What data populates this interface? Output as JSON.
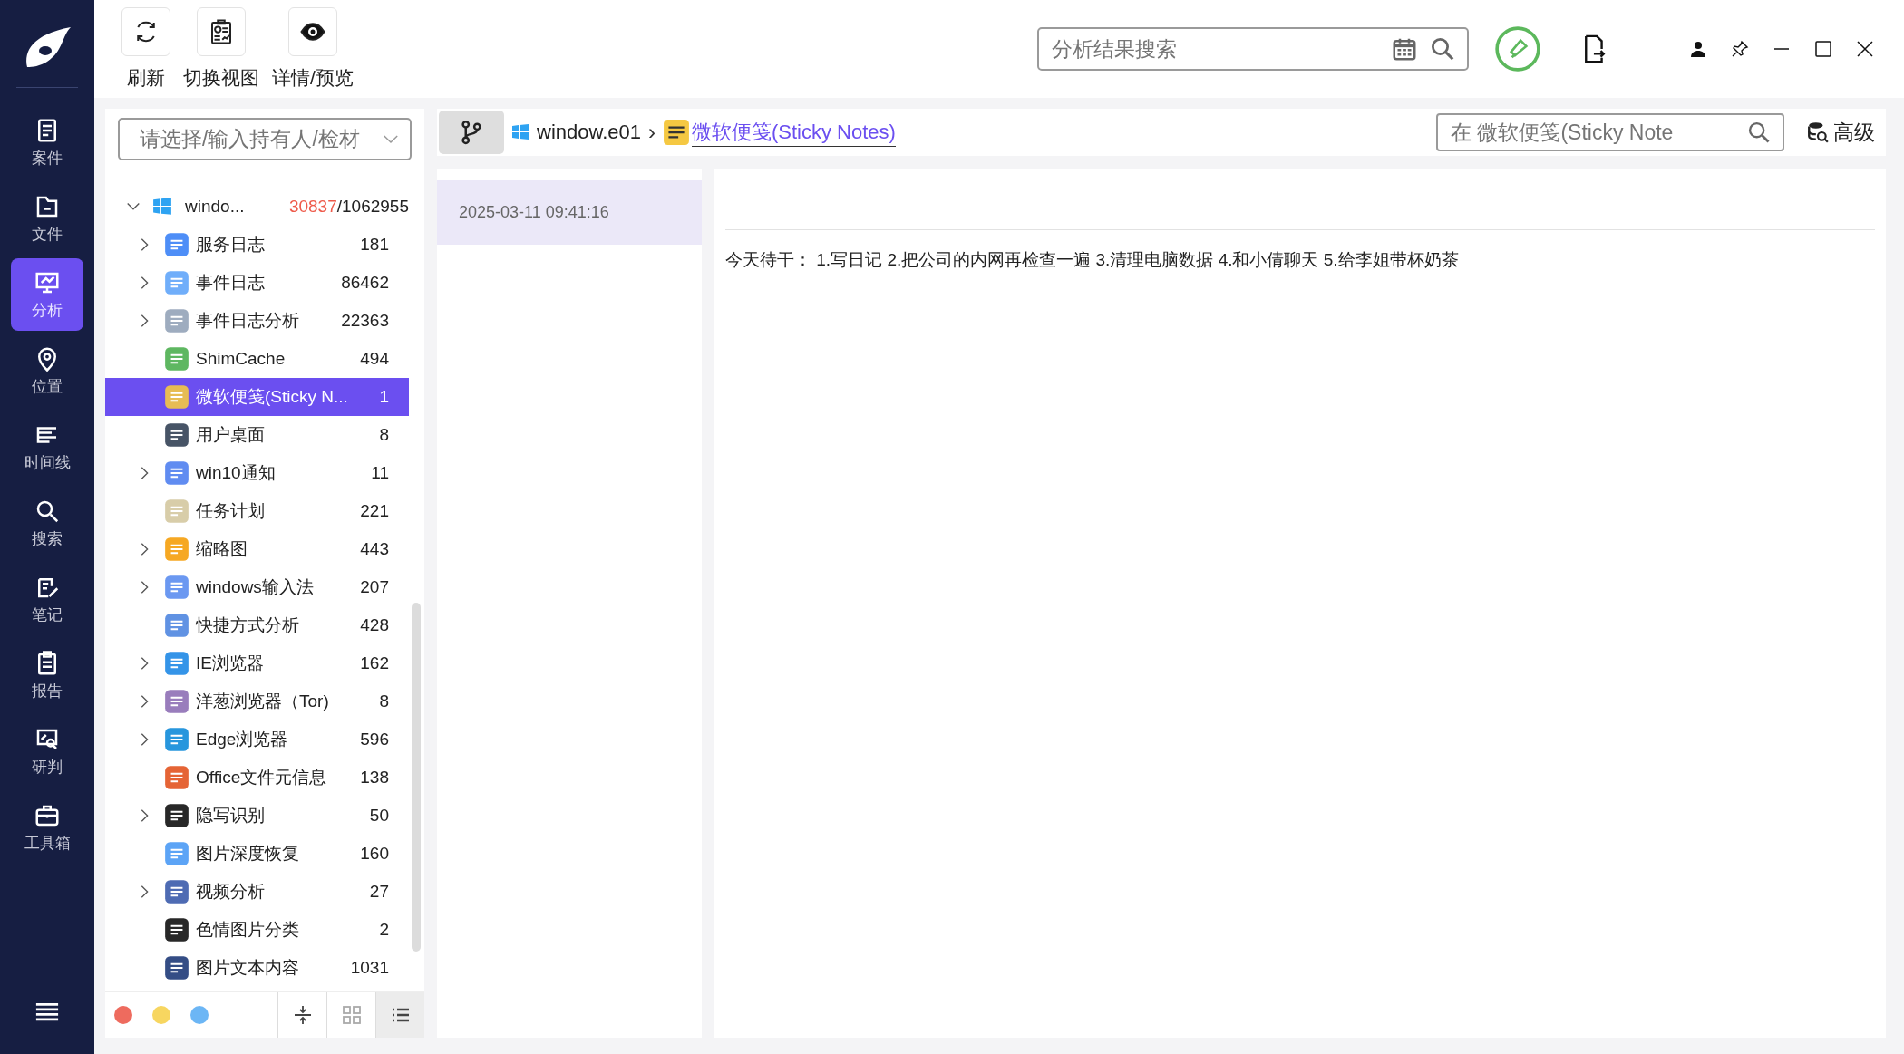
{
  "nav": [
    {
      "label": "案件",
      "selected": false
    },
    {
      "label": "文件",
      "selected": false
    },
    {
      "label": "分析",
      "selected": true
    },
    {
      "label": "位置",
      "selected": false
    },
    {
      "label": "时间线",
      "selected": false
    },
    {
      "label": "搜索",
      "selected": false
    },
    {
      "label": "笔记",
      "selected": false
    },
    {
      "label": "报告",
      "selected": false
    },
    {
      "label": "研判",
      "selected": false
    },
    {
      "label": "工具箱",
      "selected": false
    }
  ],
  "toolbar": [
    "刷新",
    "切换视图",
    "详情/预览"
  ],
  "search": {
    "placeholder": "分析结果搜索"
  },
  "owner_select": {
    "placeholder": "请选择/输入持有人/检材"
  },
  "tree": {
    "label": "windo...",
    "count_hit": "30837",
    "count_total": "/1062955",
    "expanded": true,
    "children": [
      {
        "label": "服务日志",
        "count": "181",
        "expandable": true,
        "selected": false
      },
      {
        "label": "事件日志",
        "count": "86462",
        "expandable": true,
        "selected": false
      },
      {
        "label": "事件日志分析",
        "count": "22363",
        "expandable": true,
        "selected": false
      },
      {
        "label": "ShimCache",
        "count": "494",
        "expandable": false,
        "selected": false
      },
      {
        "label": "微软便笺(Sticky N...",
        "count": "1",
        "expandable": false,
        "selected": true
      },
      {
        "label": "用户桌面",
        "count": "8",
        "expandable": false,
        "selected": false
      },
      {
        "label": "win10通知",
        "count": "11",
        "expandable": true,
        "selected": false
      },
      {
        "label": "任务计划",
        "count": "221",
        "expandable": false,
        "selected": false
      },
      {
        "label": "缩略图",
        "count": "443",
        "expandable": true,
        "selected": false
      },
      {
        "label": "windows输入法",
        "count": "207",
        "expandable": true,
        "selected": false
      },
      {
        "label": "快捷方式分析",
        "count": "428",
        "expandable": false,
        "selected": false
      },
      {
        "label": "IE浏览器",
        "count": "162",
        "expandable": true,
        "selected": false
      },
      {
        "label": "洋葱浏览器（Tor)",
        "count": "8",
        "expandable": true,
        "selected": false
      },
      {
        "label": "Edge浏览器",
        "count": "596",
        "expandable": true,
        "selected": false
      },
      {
        "label": "Office文件元信息",
        "count": "138",
        "expandable": false,
        "selected": false
      },
      {
        "label": "隐写识别",
        "count": "50",
        "expandable": true,
        "selected": false
      },
      {
        "label": "图片深度恢复",
        "count": "160",
        "expandable": false,
        "selected": false
      },
      {
        "label": "视频分析",
        "count": "27",
        "expandable": true,
        "selected": false
      },
      {
        "label": "色情图片分类",
        "count": "2",
        "expandable": false,
        "selected": false
      },
      {
        "label": "图片文本内容",
        "count": "1031",
        "expandable": false,
        "selected": false
      }
    ]
  },
  "color_filters": [
    {
      "color": "#ee6b5e"
    },
    {
      "color": "#f7d660"
    },
    {
      "color": "#6cb6f5"
    }
  ],
  "view_buttons": [
    {
      "kind": "collapse",
      "selected": false
    },
    {
      "kind": "grid",
      "selected": false
    },
    {
      "kind": "list",
      "selected": true
    }
  ],
  "breadcrumb": [
    "window.e01",
    "微软便笺(Sticky Notes)"
  ],
  "breadcrumb_separator": "›",
  "content_search": {
    "placeholder": "在 微软便笺(Sticky Note"
  },
  "advanced_button": "高级",
  "records": [
    {
      "time": "2025-03-11 09:41:16",
      "selected": true
    }
  ],
  "detail_text": "今天待干：  1.写日记 2.把公司的内网再检查一遍 3.清理电脑数据 4.和小倩聊天 5.给李姐带杯奶茶"
}
